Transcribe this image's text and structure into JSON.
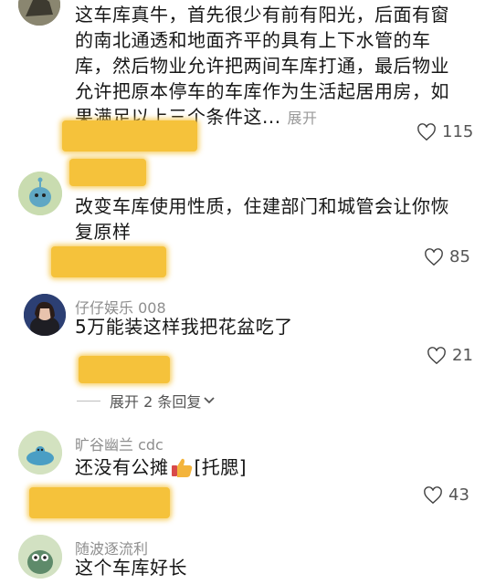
{
  "comments": [
    {
      "text_lines": [
        "这车库真牛，首先很少有前有阳光，后面有窗",
        "的南北通透和地面齐平的具有上下水管的车",
        "库，然后物业允许把两间车库打通，最后物业",
        "允许把原本停车的车库作为生活起居用房，如"
      ],
      "last_line": "果满足以上三个条件这...",
      "expand": "展开",
      "likes": "115"
    },
    {
      "text_lines": [
        "改变车库使用性质，住建部门和城管会让你恢",
        "复原样"
      ],
      "likes": "85"
    },
    {
      "user": "仔仔娱乐 008",
      "text": "5万能装这样我把花盆吃了",
      "likes": "21",
      "replies": "展开 2 条回复"
    },
    {
      "user": "旷谷幽兰 cdc",
      "text_before": "还没有公摊",
      "text_after": "[托腮]",
      "likes": "43"
    },
    {
      "user": "随波逐流利",
      "text": "这个车库好长"
    }
  ],
  "icons": {
    "like": "heart-outline-icon",
    "emoji": "thumbs-up-emoji-icon",
    "chevron": "chevron-down-icon"
  }
}
